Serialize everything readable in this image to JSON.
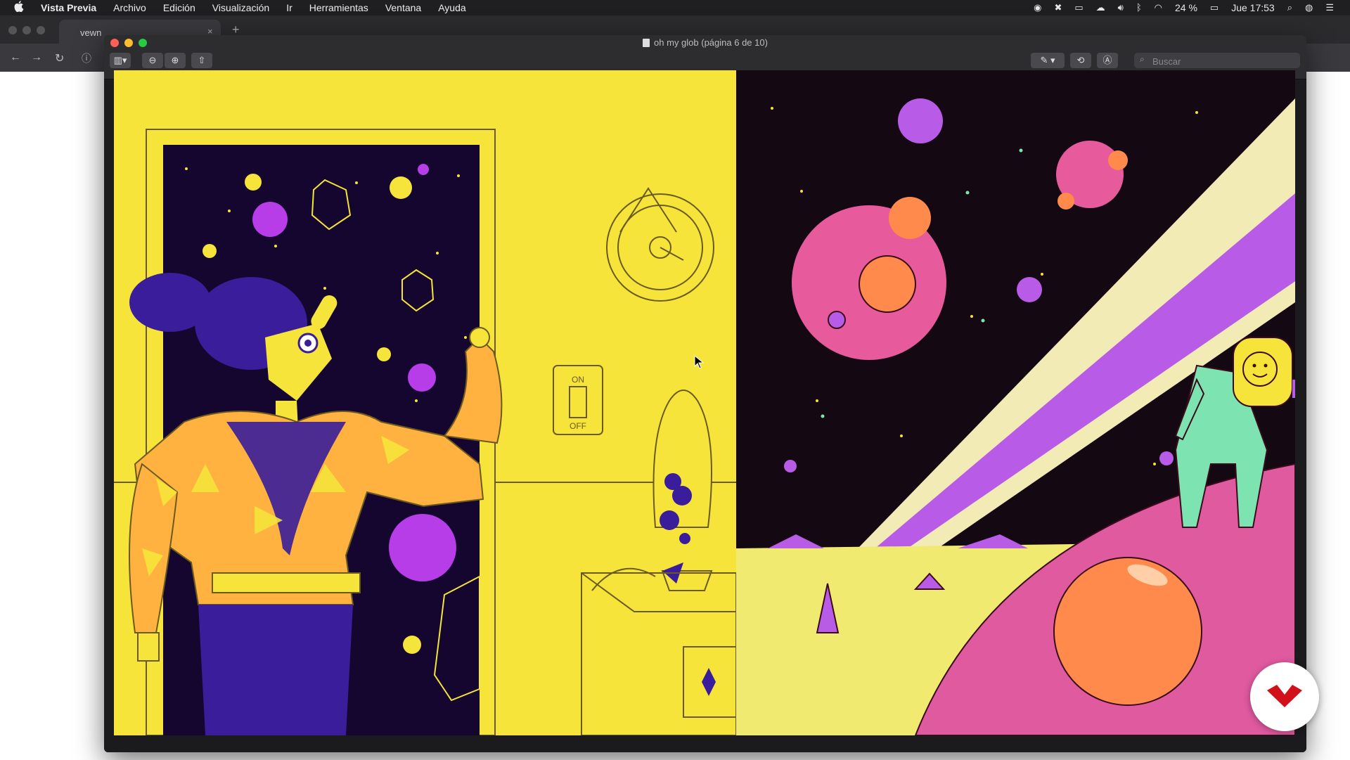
{
  "menubar": {
    "apple_icon": "apple-icon",
    "app_name": "Vista Previa",
    "menus": [
      "Archivo",
      "Edición",
      "Visualización",
      "Ir",
      "Herramientas",
      "Ventana",
      "Ayuda"
    ],
    "battery": "24 %",
    "clock": "Jue 17:53"
  },
  "browser": {
    "tab_title": "vewn",
    "tab_close": "×",
    "new_tab": "+"
  },
  "preview": {
    "window_title": "oh my glob  (página 6 de 10)",
    "search_placeholder": "Buscar"
  },
  "artwork": {
    "switch_on": "ON",
    "switch_off": "OFF"
  },
  "colors": {
    "yellow": "#f6e43a",
    "navy": "#1a0a3d",
    "purple": "#3a1d9a",
    "magenta": "#b63de8",
    "pink": "#e75a9b",
    "orange": "#ff8a4c",
    "mint": "#7de3b0",
    "badge_red": "#d2101a"
  }
}
